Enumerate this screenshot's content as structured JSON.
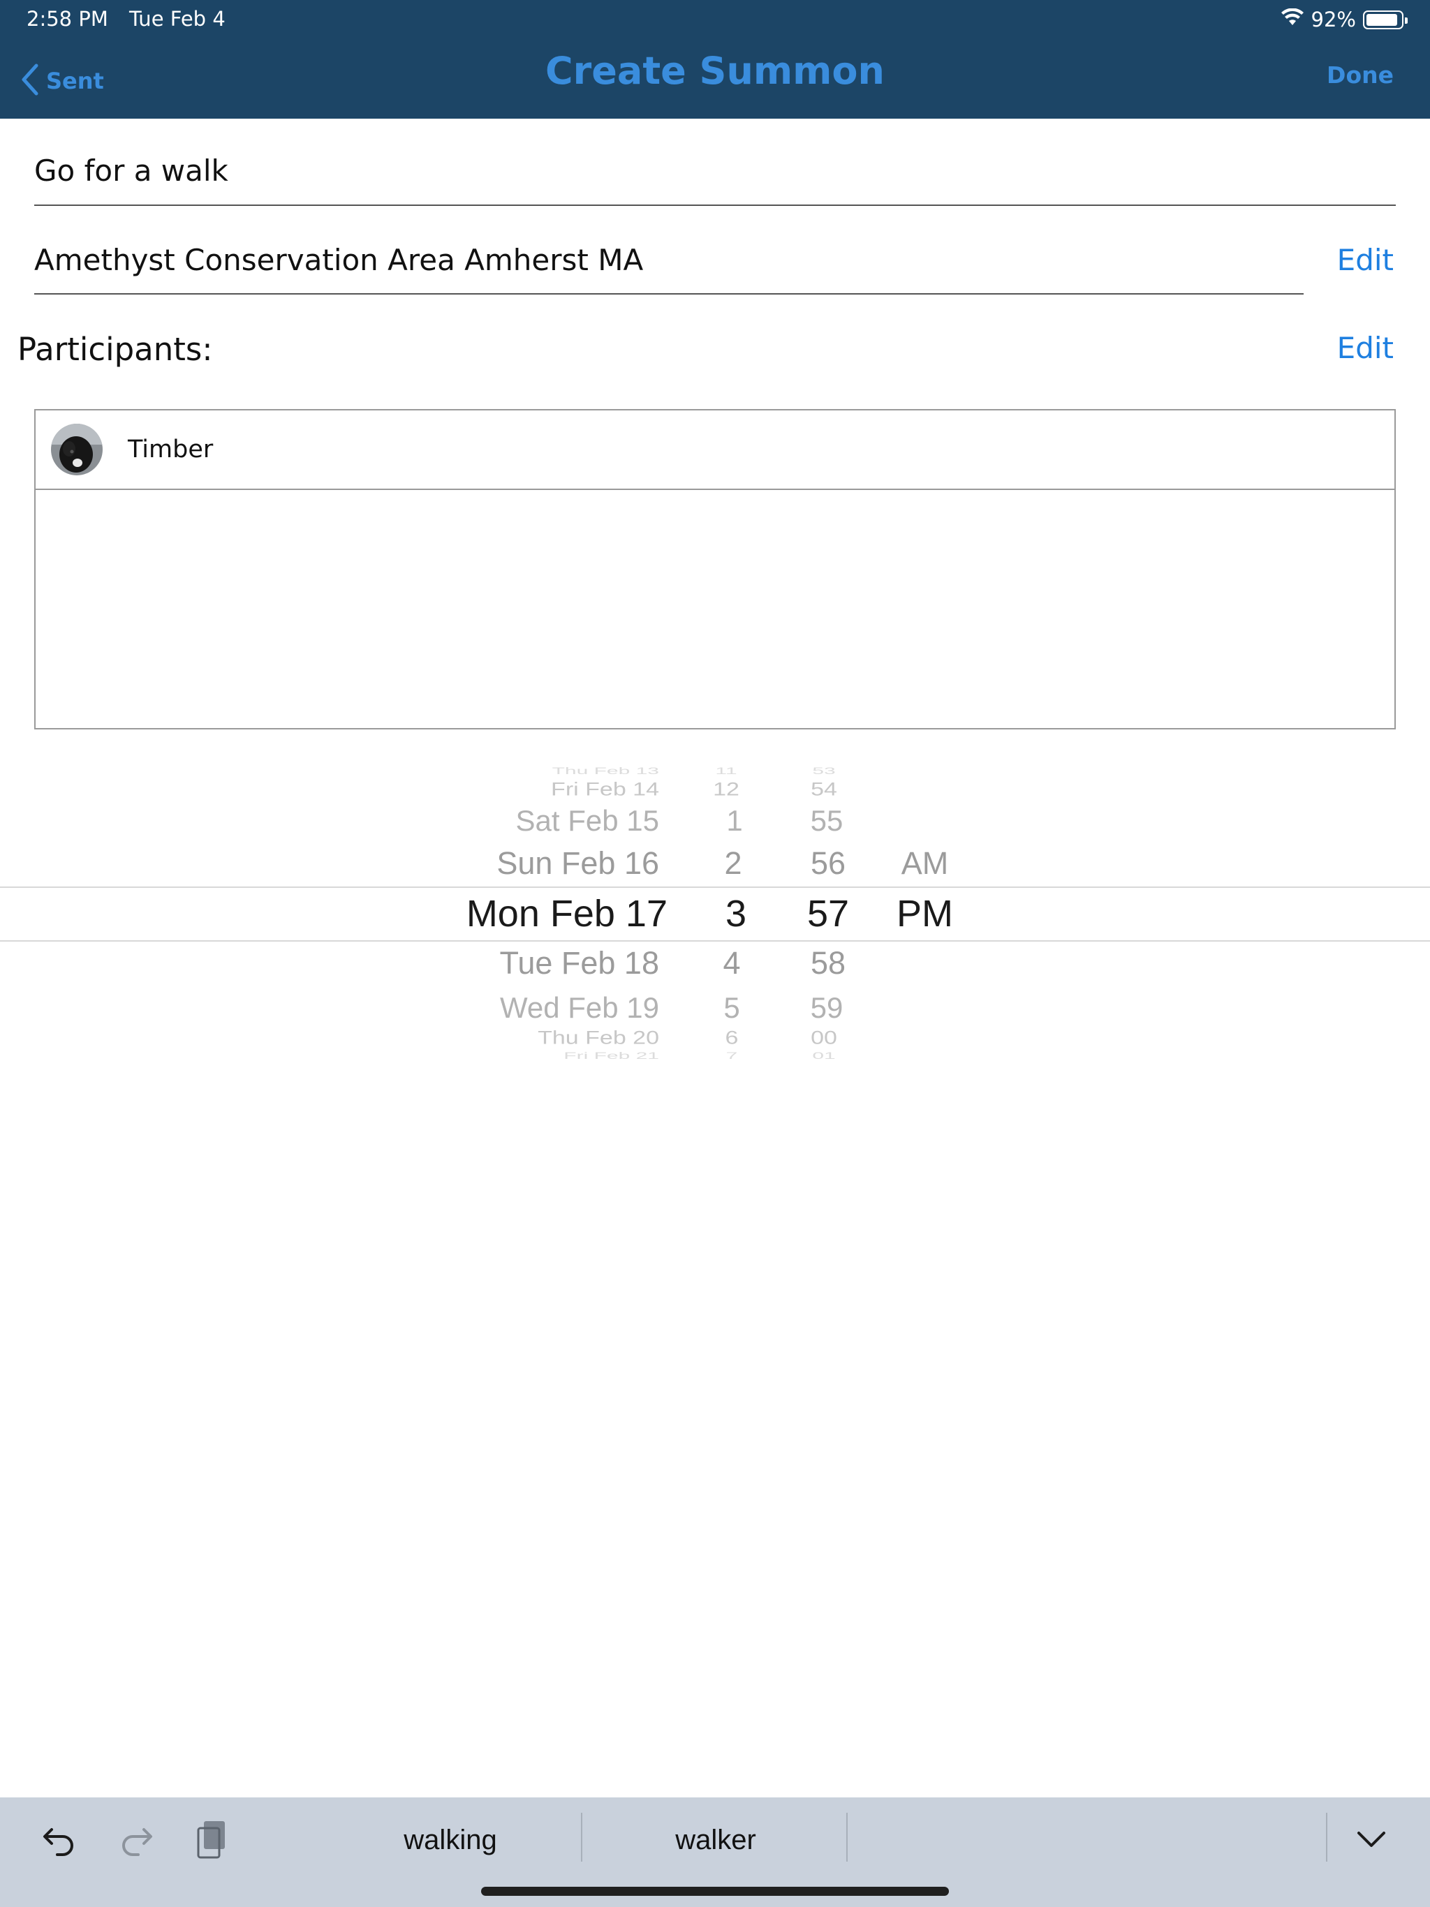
{
  "status_bar": {
    "time": "2:58 PM",
    "date": "Tue Feb 4",
    "battery_percent": "92%",
    "battery_level": 0.92
  },
  "nav": {
    "back_label": "Sent",
    "title": "Create Summon",
    "done_label": "Done"
  },
  "form": {
    "title_value": "Go for a walk",
    "location_value": "Amethyst Conservation Area Amherst MA",
    "location_edit": "Edit",
    "participants_label": "Participants:",
    "participants_edit": "Edit"
  },
  "participants": [
    {
      "name": "Timber"
    }
  ],
  "picker": {
    "dates": [
      "Thu Feb 13",
      "Fri Feb 14",
      "Sat Feb 15",
      "Sun Feb 16",
      "Mon Feb 17",
      "Tue Feb 18",
      "Wed Feb 19",
      "Thu Feb 20",
      "Fri Feb 21"
    ],
    "hours": [
      "11",
      "12",
      "1",
      "2",
      "3",
      "4",
      "5",
      "6",
      "7"
    ],
    "minutes": [
      "53",
      "54",
      "55",
      "56",
      "57",
      "58",
      "59",
      "00",
      "01"
    ],
    "ampm": [
      "AM",
      "PM"
    ],
    "selected": {
      "date": "Mon Feb 17",
      "hour": "3",
      "minute": "57",
      "ampm": "PM"
    }
  },
  "keyboard_bar": {
    "suggestions": [
      "walking",
      "walker"
    ]
  },
  "colors": {
    "header_bg": "#1c4566",
    "accent": "#3a8ddd",
    "link": "#1e7fe0",
    "keyboard_bg": "#c9d1dc"
  }
}
